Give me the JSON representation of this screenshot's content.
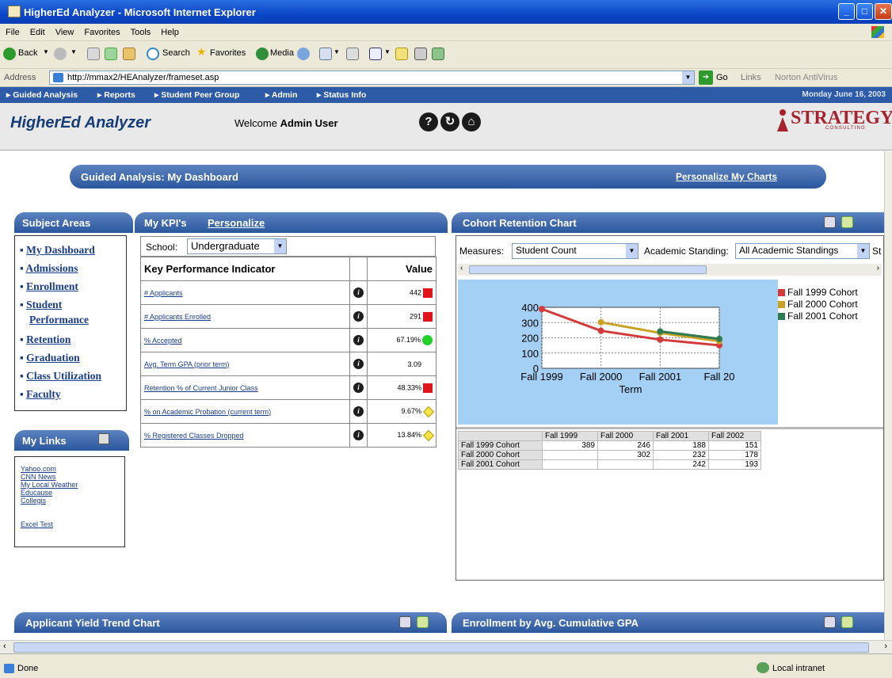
{
  "window": {
    "title": "HigherEd Analyzer - Microsoft Internet Explorer"
  },
  "menu": [
    "File",
    "Edit",
    "View",
    "Favorites",
    "Tools",
    "Help"
  ],
  "toolbar": {
    "back": "Back",
    "search": "Search",
    "favorites": "Favorites",
    "media": "Media"
  },
  "address": {
    "label": "Address",
    "url": "http://mmax2/HEAnalyzer/frameset.asp",
    "go": "Go",
    "links": "Links",
    "norton": "Norton AntiVirus"
  },
  "nav": {
    "items": [
      "Guided Analysis",
      "Reports",
      "Student Peer Group",
      "Admin",
      "Status Info"
    ],
    "date": "Monday June 16, 2003"
  },
  "header": {
    "app": "HigherEd Analyzer",
    "welcome": "Welcome",
    "user": "Admin User",
    "logo": "STRATEGY",
    "logo_sub": "CONSULTING"
  },
  "dashboard": {
    "title": "Guided Analysis: My Dashboard",
    "personalize": "Personalize My Charts"
  },
  "subjects": {
    "title": "Subject Areas",
    "items": [
      "My Dashboard",
      "Admissions",
      "Enrollment",
      "Student",
      "Performance",
      "Retention",
      "Graduation",
      "Class Utilization",
      "Faculty"
    ]
  },
  "links": {
    "title": "My Links",
    "items": [
      "Yahoo.com",
      "CNN News",
      "My Local Weather",
      "Educause",
      "Collegis",
      "Excel Test"
    ]
  },
  "kpi": {
    "title": "My KPI's",
    "personalize": "Personalize",
    "school_label": "School:",
    "school_value": "Undergraduate",
    "col_kpi": "Key Performance Indicator",
    "col_value": "Value",
    "rows": [
      {
        "name": "# Applicants",
        "value": "442",
        "status": "red"
      },
      {
        "name": "# Applicants Enrolled",
        "value": "291",
        "status": "red"
      },
      {
        "name": "% Accepted",
        "value": "67.19%",
        "status": "green"
      },
      {
        "name": "Avg. Term GPA (prior term)",
        "value": "3.09",
        "status": "none"
      },
      {
        "name": "Retention % of Current Junior Class",
        "value": "48.33%",
        "status": "red"
      },
      {
        "name": "% on Academic Probation (current term)",
        "value": "9.67%",
        "status": "yellow"
      },
      {
        "name": "% Registered Classes Dropped",
        "value": "13.84%",
        "status": "yellow"
      }
    ]
  },
  "cohort": {
    "title": "Cohort Retention Chart",
    "measures_label": "Measures:",
    "measures_value": "Student Count",
    "standing_label": "Academic Standing:",
    "standing_value": "All Academic Standings",
    "standing_cut": "St"
  },
  "chart_data": {
    "type": "line",
    "categories": [
      "Fall 1999",
      "Fall 2000",
      "Fall 2001",
      "Fall 20"
    ],
    "xlabel": "Term",
    "ylabel": "",
    "ylim": [
      0,
      400
    ],
    "yticks": [
      "400",
      "300",
      "200",
      "100",
      "0"
    ],
    "legend": "right",
    "series": [
      {
        "name": "Fall 1999 Cohort",
        "color": "#d43a3a",
        "values": [
          389,
          246,
          188,
          151
        ]
      },
      {
        "name": "Fall 2000 Cohort",
        "color": "#c9a227",
        "values": [
          null,
          302,
          232,
          178
        ]
      },
      {
        "name": "Fall 2001 Cohort",
        "color": "#2f7a52",
        "values": [
          null,
          null,
          242,
          193
        ]
      }
    ]
  },
  "pivot": {
    "cols": [
      "Fall 1999",
      "Fall 2000",
      "Fall 2001",
      "Fall 2002"
    ],
    "rows": [
      {
        "label": "Fall 1999 Cohort",
        "vals": [
          "389",
          "246",
          "188",
          "151"
        ]
      },
      {
        "label": "Fall 2000 Cohort",
        "vals": [
          "",
          "302",
          "232",
          "178"
        ]
      },
      {
        "label": "Fall 2001 Cohort",
        "vals": [
          "",
          "",
          "242",
          "193"
        ]
      }
    ]
  },
  "bottom": {
    "left_title": "Applicant Yield Trend Chart",
    "right_title": "Enrollment by Avg. Cumulative GPA"
  },
  "status": {
    "done": "Done",
    "zone": "Local intranet"
  }
}
